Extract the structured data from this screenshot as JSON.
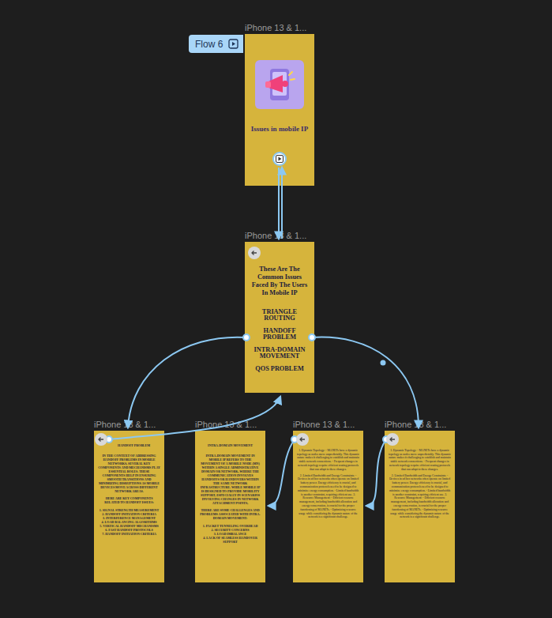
{
  "flow": {
    "label": "Flow 6"
  },
  "frames": [
    {
      "kind": "cover",
      "label": "iPhone 13 & 1...",
      "title": "Issues in mobile IP"
    },
    {
      "kind": "menu",
      "label": "iPhone 13 & 1...",
      "title": "These Are The Common Issues Faced By The Users In Mobile IP",
      "items": [
        "TRIANGLE ROUTING",
        "HANDOFF PROBLEM",
        "INTRA-DOMAIN MOVEMENT",
        "QOS PROBLEM"
      ]
    },
    {
      "kind": "article",
      "label": "iPhone 13 & 1...",
      "heading": "HANDOFF PROBLEM",
      "paragraphs": [
        "IN THE CONTEXT OF ADDRESSING HANDOFF PROBLEMS IN MOBILE NETWORKS, SEVERAL KEY COMPONENTS AND MECHANISMS PLAY ESSENTIAL ROLES. THESE COMPONENTS HELP IN ENSURING SMOOTH TRANSITIONS AND MINIMIZING DISRUPTIONS AS MOBILE DEVICES MOVE ACROSS DIFFERENT NETWORK AREAS.",
        "HERE ARE KEY COMPONENTS RELATED TO HANDOFF ISSUES:"
      ],
      "list": [
        "1. SIGNAL STRENGTH MEASUREMENT",
        "2. HANDOFF INITIATION CRITERIA",
        "3. INTERFERENCE MANAGEMENT",
        "4. LOAD BALANCING ALGORITHMS",
        "5. VERTICAL HANDOFF MECHANISMS",
        "6. FAST HANDOFF PROTOCOLS",
        "7. HANDOFF INITIATION CRITERIA"
      ]
    },
    {
      "kind": "article",
      "label": "iPhone 13 & 1...",
      "heading": "INTRA-DOMAIN MOVEMENT",
      "paragraphs": [
        "INTRA-DOMAIN MOVEMENT IN MOBILE IP REFERS TO THE MOVEMENT OF A MOBILE NODE (MN) WITHIN A SINGLE ADMINISTRATIVE DOMAIN OR NETWORK, WHERE THE COMMUNICATION INVOLVES HANDOFFS OR HANDOVERS WITHIN THE SAME NETWORK INFRASTRUCTURE. WHILE MOBILE IP IS DESIGNED TO PROVIDE MOBILITY SUPPORT, ESPECIALLY IN SCENARIOS INVOLVING CHANGES IN NETWORK ATTACHMENT POINTS,",
        "THERE ARE SOME CHALLENGES AND PROBLEMS ASSOCIATED WITH INTRA-DOMAIN MOVEMENT:"
      ],
      "list": [
        "1. PACKET TUNNELING OVERHEAD",
        "2. SECURITY CONCERNS",
        "3. LOAD IMBALANCE",
        "4. LACK OF SEAMLESS HANDOVER SUPPORT"
      ]
    },
    {
      "kind": "notes",
      "label": "iPhone 13 & 1...",
      "paragraphs": [
        "1. Dynamic Topology: - MANETs have a dynamic topology as nodes move unpredictably. This dynamic nature makes it challenging to establish and maintain stable network connections. - Frequent changes in network topology require efficient routing protocols that can adapt to these changes.",
        "2. Limited Bandwidth and Energy Constraints: - Devices in ad hoc networks often operate on limited battery power. Energy efficiency is crucial, and communication protocols need to be designed to minimize energy consumption. - Limited bandwidth is another constraint, requiring efficient use. 3. Resource Management: - Efficient resource management, including bandwidth allocation and energy conservation, is crucial for the proper functioning of MANETs. - Optimizing resource usage while considering the dynamic nature of the network is a significant challenge."
      ]
    },
    {
      "kind": "notes",
      "label": "iPhone 13 & 1...",
      "paragraphs": [
        "1. Dynamic Topology: - MANETs have a dynamic topology as nodes move unpredictably. This dynamic nature makes it challenging to establish and maintain stable network connections. - Frequent changes in network topology require efficient routing protocols that can adapt to these changes.",
        "2. Limited Bandwidth and Energy Constraints: - Devices in ad hoc networks often operate on limited battery power. Energy efficiency is crucial, and communication protocols need to be designed to minimize energy consumption. - Limited bandwidth is another constraint, requiring efficient use. 3. Resource Management: - Efficient resource management, including bandwidth allocation and energy conservation, is crucial for the proper functioning of MANETs. - Optimizing resource usage while considering the dynamic nature of the network is a significant challenge."
      ]
    }
  ]
}
